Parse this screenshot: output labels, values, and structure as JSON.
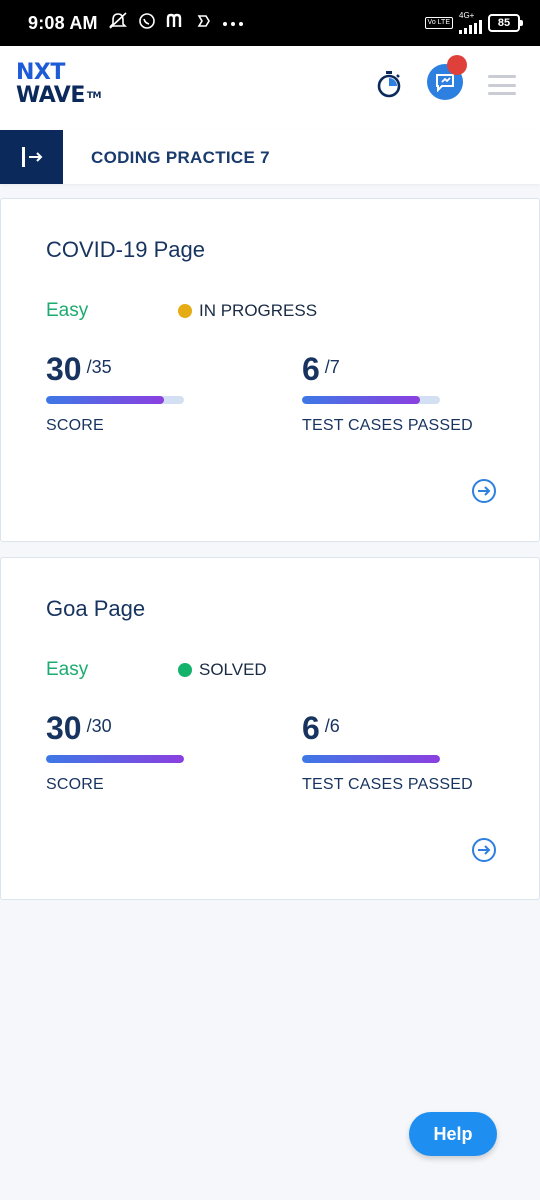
{
  "status_bar": {
    "time": "9:08 AM",
    "network_label": "4G+",
    "volte_label": "Vo LTE",
    "battery_level": "85",
    "icons": [
      "mute-icon",
      "whatsapp-icon",
      "m-app-icon",
      "app-icon",
      "more-dots-icon"
    ]
  },
  "header": {
    "logo_line1": "NXT",
    "logo_line2": "WAVE",
    "logo_tm": "TM",
    "icons": [
      "timer-icon",
      "chat-icon",
      "menu-icon"
    ],
    "notification_color": "#e0403a"
  },
  "practice": {
    "title": "CODING PRACTICE 7"
  },
  "cards": [
    {
      "title": "COVID-19 Page",
      "difficulty": "Easy",
      "status": "IN PROGRESS",
      "status_color": "#e6ac14",
      "score": {
        "value": "30",
        "total": "/35",
        "label": "SCORE",
        "fraction": 0.857
      },
      "tests": {
        "value": "6",
        "total": "/7",
        "label": "TEST CASES PASSED",
        "fraction": 0.857
      }
    },
    {
      "title": "Goa Page",
      "difficulty": "Easy",
      "status": "SOLVED",
      "status_color": "#13b26b",
      "score": {
        "value": "30",
        "total": "/30",
        "label": "SCORE",
        "fraction": 1.0
      },
      "tests": {
        "value": "6",
        "total": "/6",
        "label": "TEST CASES PASSED",
        "fraction": 1.0
      }
    }
  ],
  "help": {
    "label": "Help"
  },
  "colors": {
    "brand_dark": "#0b2a5b",
    "brand_blue": "#1e5bd7",
    "easy_green": "#1cab70",
    "help_blue": "#1e8ff0"
  }
}
